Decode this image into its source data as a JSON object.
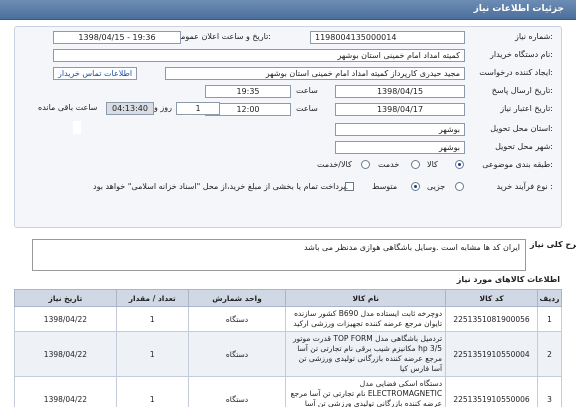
{
  "header": {
    "title": "جزئیات اطلاعات نیاز"
  },
  "form": {
    "need_number_label": "شماره نیاز:",
    "need_number": "1198004135000014",
    "announce_label": "تاریخ و ساعت اعلان عمومی:",
    "announce_value": "1398/04/15 - 19:36",
    "buyer_org_label": "نام دستگاه خریدار:",
    "buyer_org": "کمیته امداد امام خمینی استان بوشهر",
    "creator_label": "ایجاد کننده درخواست:",
    "creator": "مجید حیدری کارپرداز کمیته امداد امام خمینی استان بوشهر",
    "contact_link": "اطلاعات تماس خریدار",
    "reply_deadline_label": "تاریخ ارسال پاسخ:",
    "reply_date": "1398/04/15",
    "time_label": "ساعت",
    "reply_time": "19:35",
    "validity_label": "تاریخ اعتبار نیاز:",
    "validity_date": "1398/04/17",
    "validity_time": "12:00",
    "until_label": "تا تاریخ:",
    "days_value": "1",
    "days_label": "روز و",
    "remaining_time": "04:13:40",
    "remaining_label": "ساعت باقی مانده",
    "province_label": "استان محل تحویل:",
    "province": "بوشهر",
    "city_label": "شهر محل تحویل:",
    "city": "بوشهر",
    "category_label": "طبقه بندی موضوعی:",
    "cat_goods": "کالا",
    "cat_service": "خدمت",
    "cat_goods_service": "کالا/خدمت",
    "process_label": "نوع فرآیند خرید :",
    "proc_minor": "جزیی",
    "proc_medium": "متوسط",
    "payment_note": "پرداخت تمام یا بخشی از مبلغ خرید،از محل \"اسناد خزانه اسلامی\" خواهد بود."
  },
  "description": {
    "label": "شرح کلی نیاز:",
    "text": "ایران کد ها مشابه است .وسایل باشگاهی هوازی مدنظر می باشد"
  },
  "items_section": {
    "title": "اطلاعات کالاهای مورد نیاز",
    "columns": [
      "ردیف",
      "کد کالا",
      "نام کالا",
      "واحد شمارش",
      "تعداد / مقدار",
      "تاریخ نیاز"
    ],
    "rows": [
      {
        "idx": "1",
        "code": "2251351081900056",
        "name": "دوچرخه ثابت ایستاده مدل B690 کشور سازنده تایوان مرجع عرضه کننده تجهیزات ورزشی ارکید",
        "unit": "دستگاه",
        "qty": "1",
        "date": "1398/04/22"
      },
      {
        "idx": "2",
        "code": "2251351910550004",
        "name": "تردمیل باشگاهی مدل TOP FORM قدرت موتور hp 3/5 مکانیزم شیب برقی نام تجارتی تن آسا مرجع عرضه کننده بازرگانی تولیدی ورزشی تن آسا فارس کیا",
        "unit": "دستگاه",
        "qty": "1",
        "date": "1398/04/22"
      },
      {
        "idx": "3",
        "code": "2251351910550006",
        "name": "دستگاه اسکی فضایی مدل ELECTROMAGNETIC نام تجارتی تن آسا مرجع عرضه کننده بازرگانی تولیدی ورزشی تن آسا فارس کیا",
        "unit": "دستگاه",
        "qty": "1",
        "date": "1398/04/22"
      }
    ]
  }
}
